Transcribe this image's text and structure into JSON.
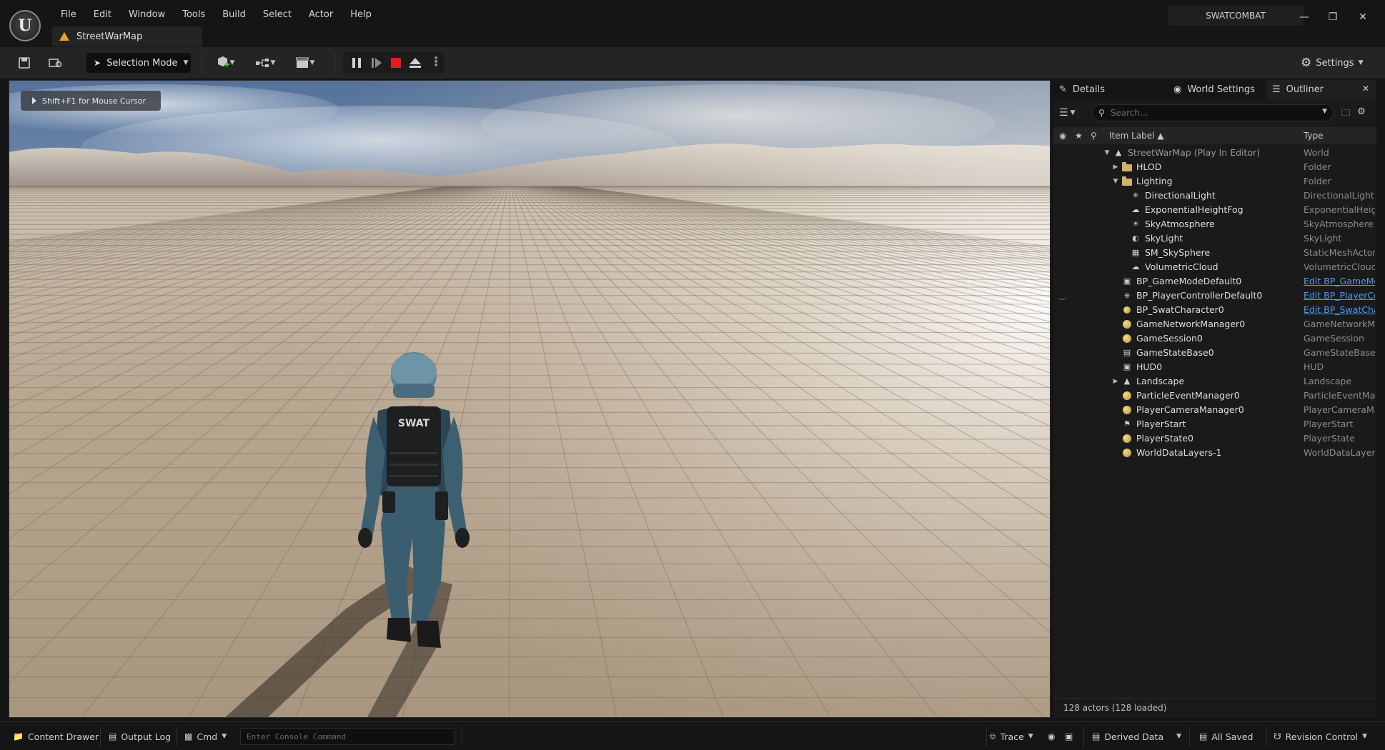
{
  "menu": [
    "File",
    "Edit",
    "Window",
    "Tools",
    "Build",
    "Select",
    "Actor",
    "Help"
  ],
  "map_tab": "StreetWarMap",
  "project_name": "SWATCOMBAT",
  "toolbar": {
    "selection_mode": "Selection Mode",
    "settings_label": "Settings"
  },
  "viewport": {
    "hint": "Shift+F1 for Mouse Cursor",
    "vest_text": "SWAT"
  },
  "panel": {
    "tabs": [
      "Details",
      "World Settings",
      "Outliner"
    ],
    "search_placeholder": "Search...",
    "columns": {
      "label": "Item Label",
      "type": "Type"
    },
    "rows": [
      {
        "label": "StreetWarMap (Play In Editor)",
        "type": "World",
        "icon": "world-icon",
        "indent": 0,
        "expander": "open",
        "dim": true
      },
      {
        "label": "HLOD",
        "type": "Folder",
        "icon": "folder-icon",
        "indent": 1,
        "expander": "closed"
      },
      {
        "label": "Lighting",
        "type": "Folder",
        "icon": "folder-icon",
        "indent": 1,
        "expander": "open"
      },
      {
        "label": "DirectionalLight",
        "type": "DirectionalLight",
        "icon": "sun-icon",
        "indent": 2
      },
      {
        "label": "ExponentialHeightFog",
        "type": "ExponentialHeigh",
        "icon": "fog-icon",
        "indent": 2
      },
      {
        "label": "SkyAtmosphere",
        "type": "SkyAtmosphere",
        "icon": "atmosphere-icon",
        "indent": 2
      },
      {
        "label": "SkyLight",
        "type": "SkyLight",
        "icon": "skylight-icon",
        "indent": 2
      },
      {
        "label": "SM_SkySphere",
        "type": "StaticMeshActor",
        "icon": "mesh-icon",
        "indent": 2
      },
      {
        "label": "VolumetricCloud",
        "type": "VolumetricCloud",
        "icon": "cloud-icon",
        "indent": 2
      },
      {
        "label": "BP_GameModeDefault0",
        "type": "Edit BP_GameMo",
        "icon": "gamemode-icon",
        "indent": 1,
        "link": true
      },
      {
        "label": "BP_PlayerControllerDefault0",
        "type": "Edit BP_PlayerCo",
        "icon": "controller-icon",
        "indent": 1,
        "link": true,
        "vis": true
      },
      {
        "label": "BP_SwatCharacter0",
        "type": "Edit BP_SwatCha",
        "icon": "character-icon",
        "indent": 1,
        "link": true
      },
      {
        "label": "GameNetworkManager0",
        "type": "GameNetworkMa",
        "icon": "actor-icon",
        "indent": 1
      },
      {
        "label": "GameSession0",
        "type": "GameSession",
        "icon": "actor-icon",
        "indent": 1
      },
      {
        "label": "GameStateBase0",
        "type": "GameStateBase",
        "icon": "gamestate-icon",
        "indent": 1
      },
      {
        "label": "HUD0",
        "type": "HUD",
        "icon": "hud-icon",
        "indent": 1
      },
      {
        "label": "Landscape",
        "type": "Landscape",
        "icon": "landscape-icon",
        "indent": 1,
        "expander": "closed"
      },
      {
        "label": "ParticleEventManager0",
        "type": "ParticleEventMan",
        "icon": "actor-icon",
        "indent": 1
      },
      {
        "label": "PlayerCameraManager0",
        "type": "PlayerCameraMa",
        "icon": "actor-icon",
        "indent": 1
      },
      {
        "label": "PlayerStart",
        "type": "PlayerStart",
        "icon": "playerstart-icon",
        "indent": 1
      },
      {
        "label": "PlayerState0",
        "type": "PlayerState",
        "icon": "actor-icon",
        "indent": 1
      },
      {
        "label": "WorldDataLayers-1",
        "type": "WorldDataLayers",
        "icon": "actor-icon",
        "indent": 1
      }
    ],
    "footer": "128 actors (128 loaded)"
  },
  "statusbar": {
    "content_drawer": "Content Drawer",
    "output_log": "Output Log",
    "cmd": "Cmd",
    "console_placeholder": "Enter Console Command",
    "trace": "Trace",
    "derived_data": "Derived Data",
    "all_saved": "All Saved",
    "revision_control": "Revision Control"
  }
}
